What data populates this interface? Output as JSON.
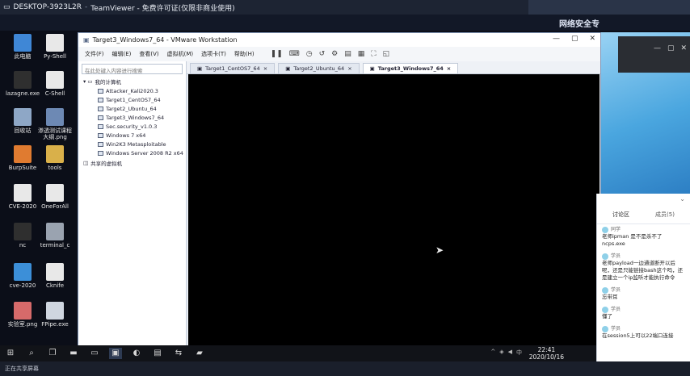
{
  "teamviewer": {
    "host": "DESKTOP-3923L2R",
    "app": "TeamViewer - 免费许可证(仅限非商业使用)"
  },
  "remote": {
    "banner": "网络安全专"
  },
  "desktop_icons": [
    {
      "label": "此电脑",
      "color": "#3f87d6"
    },
    {
      "label": "Py-Shell",
      "color": "#e8e8e8"
    },
    {
      "label": "lazagne.exe",
      "color": "#2f2f2f"
    },
    {
      "label": "C-Shell",
      "color": "#e8e8e8"
    },
    {
      "label": "回收站",
      "color": "#8ea7c6"
    },
    {
      "label": "渗透测试课程大纲.png",
      "color": "#6d89b4"
    },
    {
      "label": "BurpSuite",
      "color": "#e07b30"
    },
    {
      "label": "tools",
      "color": "#d9b04a"
    },
    {
      "label": "CVE-2020",
      "color": "#e8e8e8"
    },
    {
      "label": "OneForAll",
      "color": "#e8e8e8"
    },
    {
      "label": "nc",
      "color": "#2f2f2f"
    },
    {
      "label": "terminal_c",
      "color": "#9aa3b0"
    },
    {
      "label": "cve-2020",
      "color": "#3c8fd8"
    },
    {
      "label": "Cknife",
      "color": "#e8e8e8"
    },
    {
      "label": "实验室.png",
      "color": "#d66a6a"
    },
    {
      "label": "FPipe.exe",
      "color": "#cfd6e0"
    }
  ],
  "vmware": {
    "title": "Target3_Windows7_64 - VMware Workstation",
    "menu": [
      "文件(F)",
      "编辑(E)",
      "查看(V)",
      "虚拟机(M)",
      "选项卡(T)",
      "帮助(H)"
    ],
    "search_placeholder": "在此处键入内容进行搜索",
    "library_label": "我的计算机",
    "vms": [
      "Attacker_Kali2020.3",
      "Target1_CentOS7_64",
      "Target2_Ubuntu_64",
      "Target3_Windows7_64",
      "Sec.security_v1.0.3",
      "Windows 7 x64",
      "Win2K3 Metasploitable",
      "Windows Server 2008 R2 x64"
    ],
    "shared_label": "共享的虚拟机",
    "tabs": [
      {
        "label": "Target1_CentOS7_64",
        "active": false
      },
      {
        "label": "Target2_Ubuntu_64",
        "active": false
      },
      {
        "label": "Target3_Windows7_64",
        "active": true
      }
    ]
  },
  "chat": {
    "tab_discussion": "讨论区",
    "tab_other": "成员(5)",
    "messages": [
      {
        "user": "同学",
        "text": "老师ipman 是不是杀不了ncps.exe"
      },
      {
        "user": "学员",
        "text": "老师payload一边通道断开以后呢，还是只能链接bash这个吗，还是建立一个ip监听才能执行命令"
      },
      {
        "user": "学员",
        "text": "忘带耳"
      },
      {
        "user": "学员",
        "text": "懂了"
      },
      {
        "user": "学员",
        "text": "在session5上可以22端口连接"
      }
    ]
  },
  "taskbar": {
    "time": "22:41",
    "date": "2020/10/16"
  },
  "bottom_text": "正在共享屏幕"
}
